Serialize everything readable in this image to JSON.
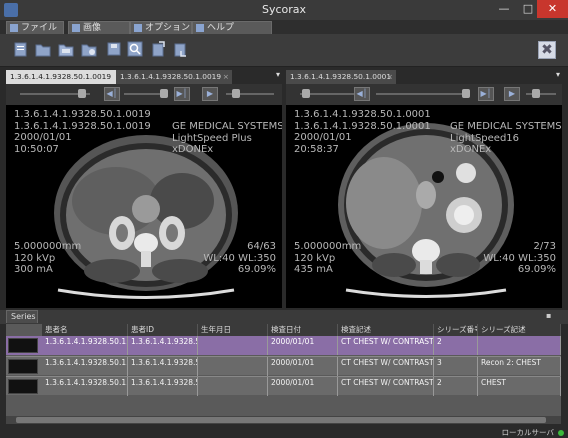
{
  "window": {
    "title": "Sycorax"
  },
  "menu": [
    "ファイル",
    "画像",
    "オプション",
    "ヘルプ"
  ],
  "toolbar": {
    "icons": [
      "open-file-icon",
      "open-folder-icon",
      "folder-icon",
      "open-dicomdir-icon",
      "save-icon",
      "search-icon",
      "export-icon",
      "import-icon"
    ],
    "close_icon": "close-icon"
  },
  "tabs_left": [
    {
      "label": "1.3.6.1.4.1.9328.50.1.0019",
      "active": true
    },
    {
      "label": "1.3.6.1.4.1.9328.50.1.0019",
      "close": "×",
      "active": false
    }
  ],
  "tabs_right": [
    {
      "label": "1.3.6.1.4.1.9328.50.1.0001",
      "close": "×",
      "active": true
    }
  ],
  "tab_dropdown": "▾",
  "viewer_left": {
    "top_left": [
      "1.3.6.1.4.1.9328.50.1.0019",
      "1.3.6.1.4.1.9328.50.1.0019",
      "2000/01/01",
      "10:50:07"
    ],
    "top_right": [
      "GE MEDICAL SYSTEMS",
      "LightSpeed Plus",
      "xDONEx"
    ],
    "bottom_left": [
      "5.000000mm",
      "120 kVp",
      "300 mA"
    ],
    "bottom_right": [
      "64/63",
      "WL:40 WL:350",
      "69.09%"
    ]
  },
  "viewer_right": {
    "top_left": [
      "1.3.6.1.4.1.9328.50.1.0001",
      "1.3.6.1.4.1.9328.50.1.0001",
      "2000/01/01",
      "20:58:37"
    ],
    "top_right": [
      "GE MEDICAL SYSTEMS",
      "LightSpeed16",
      "xDONEx"
    ],
    "bottom_left": [
      "5.000000mm",
      "120 kVp",
      "435 mA"
    ],
    "bottom_right": [
      "2/73",
      "WL:40 WL:350",
      "69.09%"
    ]
  },
  "series_panel": {
    "tab": "Series",
    "pin": "▪",
    "columns": [
      "患者名",
      "患者ID",
      "生年月日",
      "検査日付",
      "検査記述",
      "シリーズ番号",
      "シリーズ記述"
    ],
    "rows": [
      {
        "name": "1.3.6.1.4.1.9328.50.1.0",
        "id": "1.3.6.1.4.1.9328.5",
        "dob": "",
        "date": "2000/01/01",
        "desc": "CT CHEST W/ CONTRAST",
        "series_no": "2",
        "series_desc": "",
        "selected": true
      },
      {
        "name": "1.3.6.1.4.1.9328.50.1.0",
        "id": "1.3.6.1.4.1.9328.5",
        "dob": "",
        "date": "2000/01/01",
        "desc": "CT CHEST W/ CONTRAST",
        "series_no": "3",
        "series_desc": "Recon 2: CHEST",
        "selected": false
      },
      {
        "name": "1.3.6.1.4.1.9328.50.1.0",
        "id": "1.3.6.1.4.1.9328.5",
        "dob": "",
        "date": "2000/01/01",
        "desc": "CT CHEST W/ CONTRAST",
        "series_no": "2",
        "series_desc": "CHEST",
        "selected": false
      }
    ]
  },
  "status": {
    "server": "ローカルサーバ",
    "indicator_color": "#3cba3c"
  }
}
